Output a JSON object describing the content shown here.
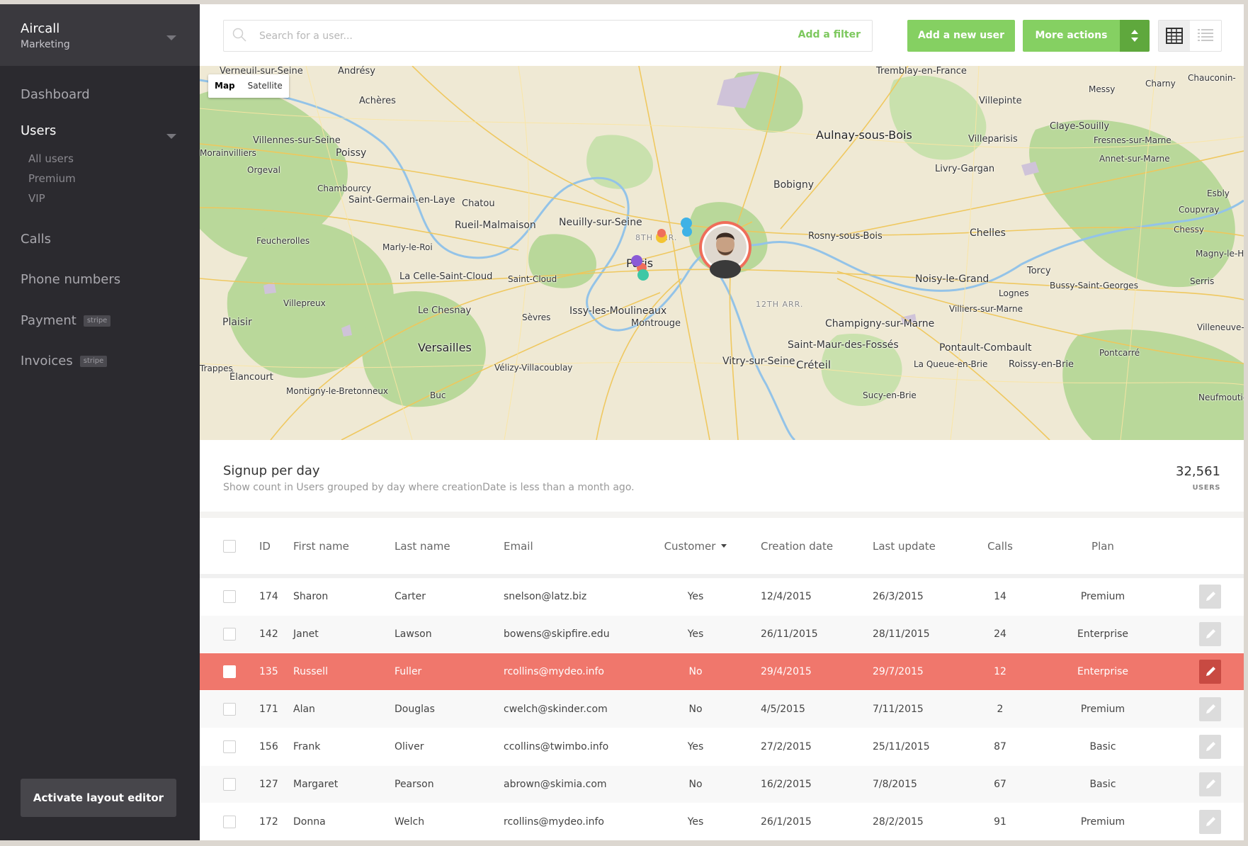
{
  "sidebar": {
    "app_name": "Aircall",
    "workspace": "Marketing",
    "items": [
      {
        "label": "Dashboard"
      },
      {
        "label": "Users"
      },
      {
        "label": "Calls"
      },
      {
        "label": "Phone numbers"
      },
      {
        "label": "Payment",
        "tag": "stripe"
      },
      {
        "label": "Invoices",
        "tag": "stripe"
      }
    ],
    "users_sub": [
      "All users",
      "Premium",
      "VIP"
    ],
    "layout_button": "Activate layout editor"
  },
  "toolbar": {
    "search_placeholder": "Search for a user...",
    "add_filter": "Add a filter",
    "add_user": "Add a new user",
    "more_actions": "More actions"
  },
  "map": {
    "type_map": "Map",
    "type_satellite": "Satellite",
    "labels": [
      "Verneuil-sur-Seine",
      "Andrésy",
      "Tremblay-en-France",
      "Chauconin-",
      "Charny",
      "Messy",
      "Achères",
      "Villepinte",
      "Aulnay-sous-Bois",
      "Villeparisis",
      "Claye-Souilly",
      "Fresnes-sur-Marne",
      "Annet-sur-Marne",
      "Villennes-sur-Seine",
      "Poissy",
      "Orgeval",
      "Morainvilliers",
      "Livry-Gargan",
      "Bobigny",
      "Chambourcy",
      "Saint-Germain-en-Laye",
      "Chatou",
      "Rueil-Malmaison",
      "Neuilly-sur-Seine",
      "Rosny-sous-Bois",
      "Chelles",
      "Esbly",
      "Coupvray",
      "Feucherolles",
      "Marly-le-Roi",
      "La Celle-Saint-Cloud",
      "Saint-Cloud",
      "Paris",
      "Noisy-le-Grand",
      "Torcy",
      "Chessy",
      "Serris",
      "Bussy-Saint-Georges",
      "Lognes",
      "Villepreux",
      "Le Chesnay",
      "Sèvres",
      "Issy-les-Moulineaux",
      "Montrouge",
      "Champigny-sur-Marne",
      "Villiers-sur-Marne",
      "Plaisir",
      "Versailles",
      "Vélizy-Villacoublay",
      "Vitry-sur-Seine",
      "Créteil",
      "Saint-Maur-des-Fossés",
      "Pontault-Combault",
      "La Queue-en-Brie",
      "Roissy-en-Brie",
      "Pontcarré",
      "Élancourt",
      "Montigny-le-Bretonneux",
      "Buc",
      "Sucy-en-Brie",
      "Neufmoutier",
      "Magny-le-Hon",
      "Villeneuve-l",
      "8TH ARR.",
      "12TH ARR.",
      "Trappes"
    ],
    "pins": [
      "blue",
      "yellow",
      "red",
      "purple",
      "teal"
    ]
  },
  "stats": {
    "title": "Signup per day",
    "description": "Show count in Users grouped by day where creationDate is less than a month ago.",
    "count": "32,561",
    "unit": "USERS"
  },
  "table": {
    "headers": {
      "id": "ID",
      "first_name": "First name",
      "last_name": "Last name",
      "email": "Email",
      "customer": "Customer",
      "creation_date": "Creation date",
      "last_update": "Last update",
      "calls": "Calls",
      "plan": "Plan"
    },
    "rows": [
      {
        "id": "174",
        "first": "Sharon",
        "last": "Carter",
        "email": "snelson@latz.biz",
        "customer": "Yes",
        "created": "12/4/2015",
        "updated": "26/3/2015",
        "calls": "14",
        "plan": "Premium"
      },
      {
        "id": "142",
        "first": "Janet",
        "last": "Lawson",
        "email": "bowens@skipfire.edu",
        "customer": "Yes",
        "created": "26/11/2015",
        "updated": "28/11/2015",
        "calls": "24",
        "plan": "Enterprise"
      },
      {
        "id": "135",
        "first": "Russell",
        "last": "Fuller",
        "email": "rcollins@mydeo.info",
        "customer": "No",
        "created": "29/4/2015",
        "updated": "29/7/2015",
        "calls": "12",
        "plan": "Enterprise"
      },
      {
        "id": "171",
        "first": "Alan",
        "last": "Douglas",
        "email": "cwelch@skinder.com",
        "customer": "No",
        "created": "4/5/2015",
        "updated": "7/11/2015",
        "calls": "2",
        "plan": "Premium"
      },
      {
        "id": "156",
        "first": "Frank",
        "last": "Oliver",
        "email": "ccollins@twimbo.info",
        "customer": "Yes",
        "created": "27/2/2015",
        "updated": "25/11/2015",
        "calls": "87",
        "plan": "Basic"
      },
      {
        "id": "127",
        "first": "Margaret",
        "last": "Pearson",
        "email": "abrown@skimia.com",
        "customer": "No",
        "created": "16/2/2015",
        "updated": "7/8/2015",
        "calls": "67",
        "plan": "Basic"
      },
      {
        "id": "172",
        "first": "Donna",
        "last": "Welch",
        "email": "rcollins@mydeo.info",
        "customer": "Yes",
        "created": "26/1/2015",
        "updated": "28/2/2015",
        "calls": "91",
        "plan": "Premium"
      }
    ],
    "highlighted_row": "135"
  },
  "colors": {
    "sidebar_bg": "#2b2a2f",
    "accent_green": "#85d062",
    "highlight_red": "#f0776c"
  }
}
